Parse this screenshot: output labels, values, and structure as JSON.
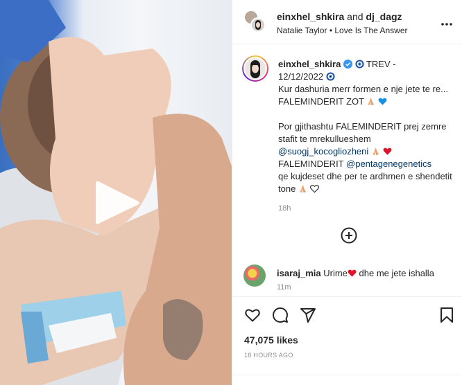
{
  "header": {
    "user1": "einxhel_shkira",
    "and_text": "and",
    "user2": "dj_dagz",
    "subtitle": "Natalie Taylor • Love Is The Answer"
  },
  "caption": {
    "username": "einxhel_shkira",
    "line1_rest": " TREV -",
    "line2": "12/12/2022",
    "text1": "Kur dashuria merr formen e nje jete te re... FALEMINDERIT ZOT",
    "text2": "Por gjithashtu FALEMINDERIT prej zemre stafit te mrekullueshem",
    "mention1": "@suogj_kocogliozheni",
    "text3": "FALEMINDERIT",
    "mention2": "@pentagenegenetics",
    "text4": "qe kujdeset dhe per te ardhmen e shendetit tone",
    "time": "18h"
  },
  "comment": {
    "username": "isaraj_mia",
    "text1": "Urime",
    "text2": "dhe me jete ishalla",
    "time": "11m"
  },
  "footer": {
    "likes": "47,075 likes",
    "date": "18 HOURS AGO"
  },
  "colors": {
    "verified": "#3897f0",
    "mention": "#00376b",
    "heart_red": "#e0142b",
    "heart_blue": "#1d8fe0"
  },
  "icons": [
    "more-icon",
    "verified-icon",
    "evil-eye-icon",
    "praying-hands-icon",
    "heart-icon",
    "plus-circle-icon",
    "comment-icon",
    "share-icon",
    "bookmark-icon",
    "play-icon"
  ]
}
